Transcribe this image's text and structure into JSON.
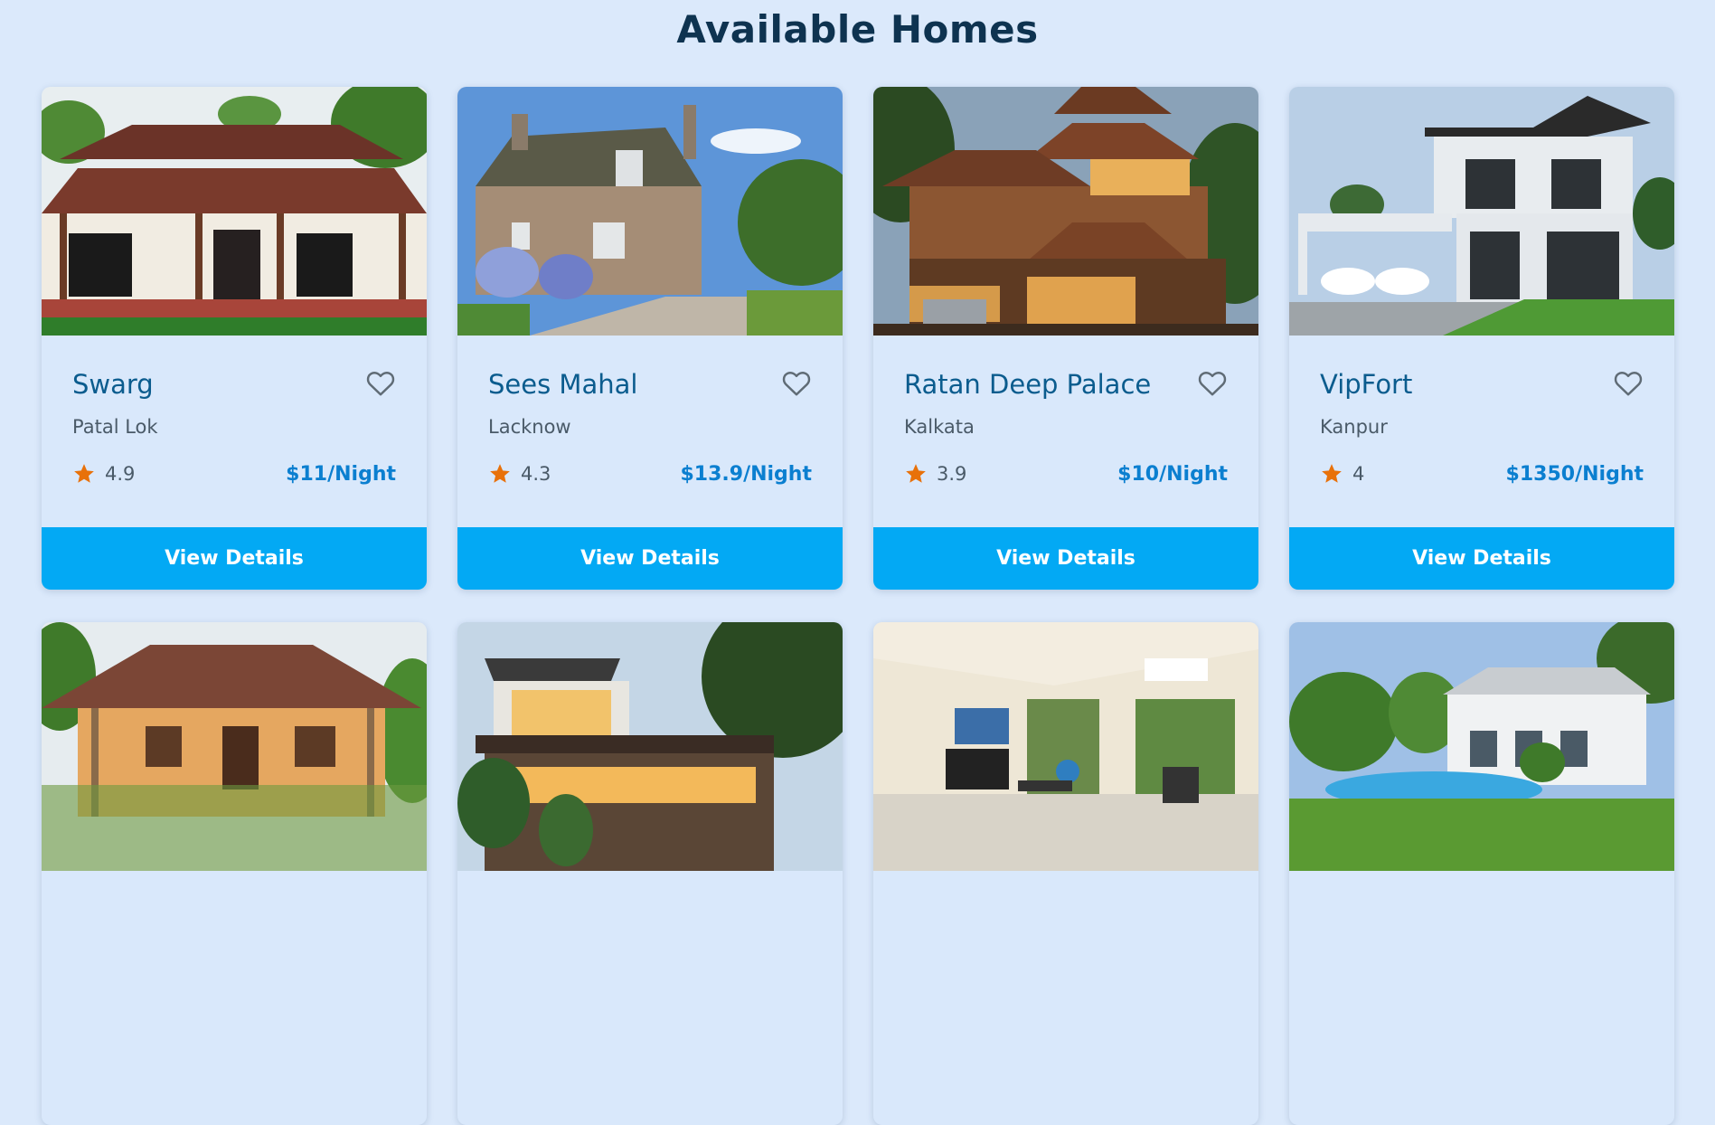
{
  "page": {
    "title": "Available Homes"
  },
  "colors": {
    "background": "#dbe9fb",
    "accent": "#03a9f4",
    "price": "#0b7fd0",
    "star": "#e8710a",
    "title": "#0e3350"
  },
  "homes": [
    {
      "name": "Swarg",
      "location": "Patal Lok",
      "rating": "4.9",
      "price": "$11/Night",
      "button_label": "View Details",
      "image": "colonial-bungalow-photo"
    },
    {
      "name": "Sees Mahal",
      "location": "Lacknow",
      "rating": "4.3",
      "price": "$13.9/Night",
      "button_label": "View Details",
      "image": "stone-cottage-photo"
    },
    {
      "name": "Ratan Deep Palace",
      "location": "Kalkata",
      "rating": "3.9",
      "price": "$10/Night",
      "button_label": "View Details",
      "image": "wooden-villa-photo"
    },
    {
      "name": "VipFort",
      "location": "Kanpur",
      "rating": "4",
      "price": "$1350/Night",
      "button_label": "View Details",
      "image": "modern-house-photo"
    },
    {
      "image": "tiled-roof-cottage-photo"
    },
    {
      "image": "modern-lit-house-photo"
    },
    {
      "image": "home-gym-photo"
    },
    {
      "image": "white-house-pool-photo"
    }
  ],
  "icons": {
    "favorite": "heart-icon",
    "rating": "star-icon"
  }
}
